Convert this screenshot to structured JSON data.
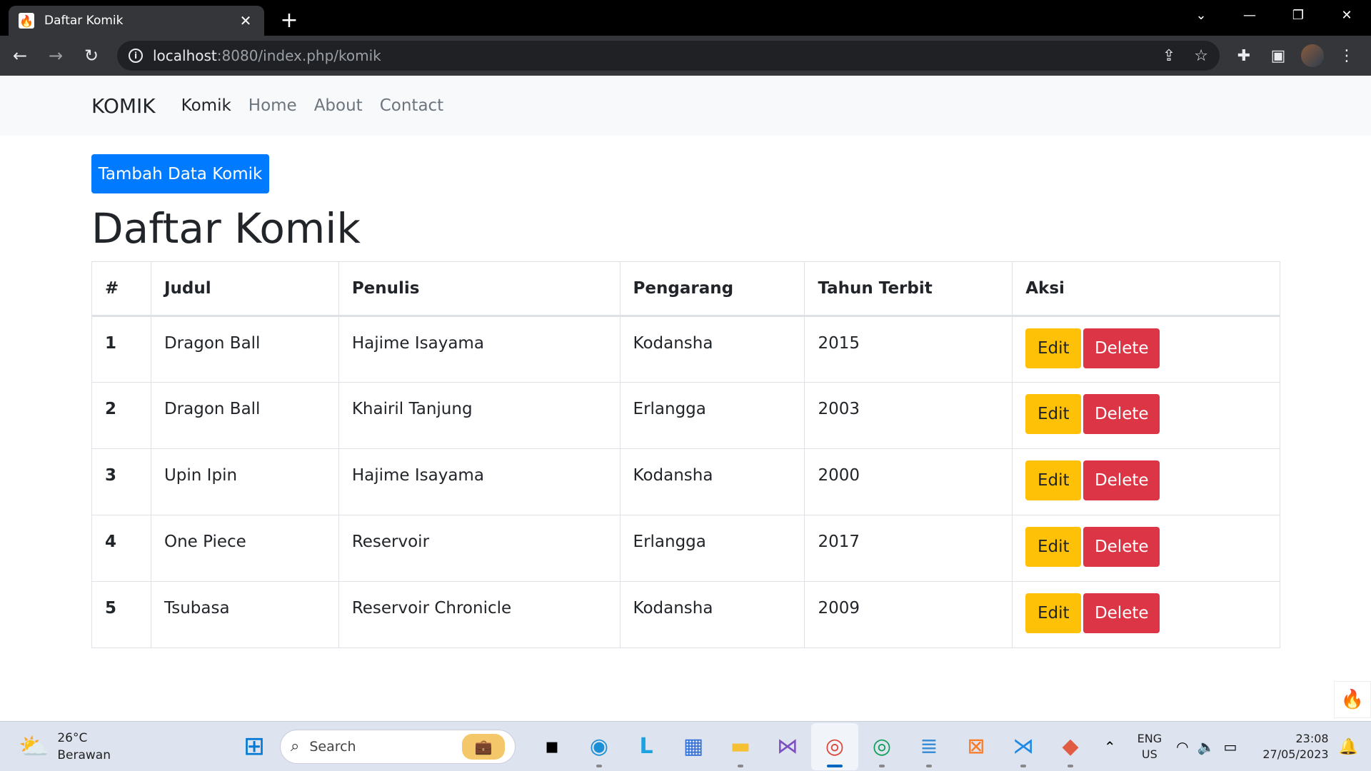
{
  "browser": {
    "tab_title": "Daftar Komik",
    "tab_close": "✕",
    "new_tab": "+",
    "url_host": "localhost",
    "url_rest": ":8080/index.php/komik",
    "window_controls": {
      "dropdown": "⌄",
      "minimize": "—",
      "restore": "❐",
      "close": "✕"
    }
  },
  "navbar": {
    "brand": "KOMIK",
    "links": [
      "Komik",
      "Home",
      "About",
      "Contact"
    ]
  },
  "page": {
    "add_button": "Tambah Data Komik",
    "title": "Daftar Komik"
  },
  "table": {
    "headers": [
      "#",
      "Judul",
      "Penulis",
      "Pengarang",
      "Tahun Terbit",
      "Aksi"
    ],
    "rows": [
      {
        "num": "1",
        "judul": "Dragon Ball",
        "penulis": "Hajime Isayama",
        "pengarang": "Kodansha",
        "tahun": "2015"
      },
      {
        "num": "2",
        "judul": "Dragon Ball",
        "penulis": "Khairil Tanjung",
        "pengarang": "Erlangga",
        "tahun": "2003"
      },
      {
        "num": "3",
        "judul": "Upin Ipin",
        "penulis": "Hajime Isayama",
        "pengarang": "Kodansha",
        "tahun": "2000"
      },
      {
        "num": "4",
        "judul": "One Piece",
        "penulis": "Reservoir",
        "pengarang": "Erlangga",
        "tahun": "2017"
      },
      {
        "num": "5",
        "judul": "Tsubasa",
        "penulis": "Reservoir Chronicle",
        "pengarang": "Kodansha",
        "tahun": "2009"
      }
    ],
    "edit_label": "Edit",
    "delete_label": "Delete"
  },
  "taskbar": {
    "weather_temp": "26°C",
    "weather_desc": "Berawan",
    "search_label": "Search",
    "lang_1": "ENG",
    "lang_2": "US",
    "time": "23:08",
    "date": "27/05/2023"
  },
  "colors": {
    "primary": "#007bff",
    "warning": "#ffc107",
    "danger": "#dc3545",
    "navbar_bg": "#f8f9fa",
    "chrome_dark": "#35363a"
  }
}
